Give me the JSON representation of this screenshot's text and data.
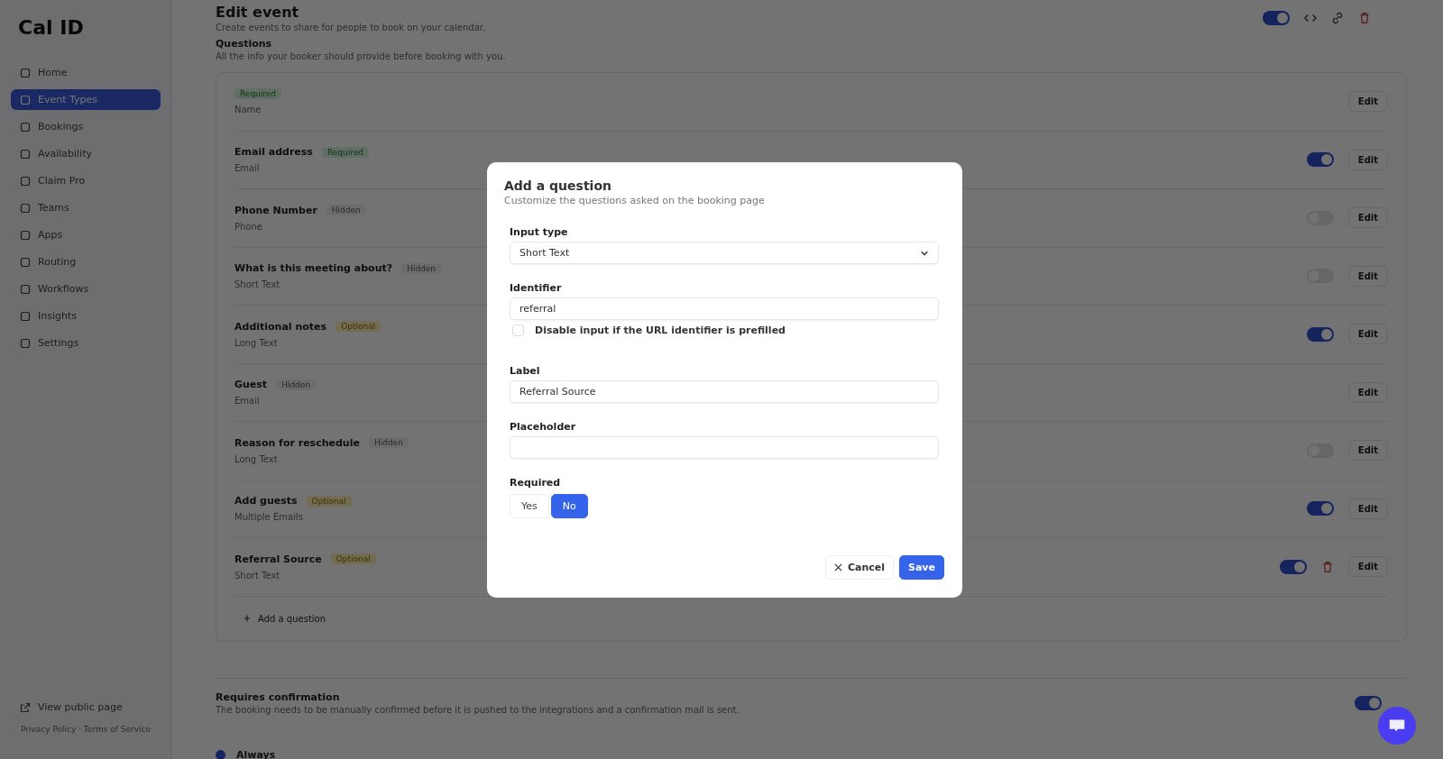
{
  "sidebar": {
    "logo": "Cal ID",
    "items": [
      {
        "label": "Home",
        "selected": false
      },
      {
        "label": "Event Types",
        "selected": true
      },
      {
        "label": "Bookings",
        "selected": false
      },
      {
        "label": "Availability",
        "selected": false
      },
      {
        "label": "Claim Pro",
        "selected": false
      },
      {
        "label": "Teams",
        "selected": false
      },
      {
        "label": "Apps",
        "selected": false
      },
      {
        "label": "Routing",
        "selected": false
      },
      {
        "label": "Workflows",
        "selected": false
      },
      {
        "label": "Insights",
        "selected": false
      },
      {
        "label": "Settings",
        "selected": false
      }
    ],
    "view_public_page": "View public page",
    "footer": "Privacy Policy · Terms of Service"
  },
  "header": {
    "title": "Edit event",
    "subtitle": "Create events to share for people to book on your calendar.",
    "switch_on": true
  },
  "questions": {
    "title": "Questions",
    "subtitle": "All the info your booker should provide before booking with you.",
    "rows": [
      {
        "badge": {
          "text": "Required",
          "kind": "required"
        },
        "type": "Name",
        "edit": "Edit"
      },
      {
        "label": "Email address",
        "badge": {
          "text": "Required",
          "kind": "required"
        },
        "type": "Email",
        "on": true,
        "edit": "Edit"
      },
      {
        "label": "Phone Number",
        "badge": {
          "text": "Hidden",
          "kind": "hidden"
        },
        "type": "Phone",
        "on": false,
        "edit": "Edit"
      },
      {
        "label": "What is this meeting about?",
        "badge": {
          "text": "Hidden",
          "kind": "hidden"
        },
        "type": "Short Text",
        "on": false,
        "edit": "Edit"
      },
      {
        "label": "Additional notes",
        "badge": {
          "text": "Optional",
          "kind": "optional"
        },
        "type": "Long Text",
        "on": true,
        "edit": "Edit"
      },
      {
        "label": "Guest",
        "badge": {
          "text": "Hidden",
          "kind": "hidden"
        },
        "type": "Email",
        "edit": "Edit"
      },
      {
        "label": "Reason for reschedule",
        "badge": {
          "text": "Hidden",
          "kind": "hidden"
        },
        "type": "Long Text",
        "on": false,
        "edit": "Edit"
      },
      {
        "label": "Add guests",
        "badge": {
          "text": "Optional",
          "kind": "optional"
        },
        "type": "Multiple Emails",
        "on": true,
        "edit": "Edit"
      },
      {
        "label": "Referral Source",
        "badge": {
          "text": "Optional",
          "kind": "optional"
        },
        "type": "Short Text",
        "on": true,
        "deletable": true,
        "edit": "Edit"
      }
    ],
    "add_label": "Add a question"
  },
  "confirmation": {
    "title": "Requires confirmation",
    "subtitle": "The booking needs to be manually confirmed before it is pushed to the integrations and a confirmation mail is sent.",
    "on": true,
    "option": "Always",
    "option_selected": true
  },
  "dialog": {
    "title": "Add a question",
    "subtitle": "Customize the questions asked on the booking page",
    "input_type": {
      "label": "Input type",
      "value": "Short Text"
    },
    "identifier": {
      "label": "Identifier",
      "value": "referral"
    },
    "disable_prefilled": {
      "label": "Disable input if the URL identifier is prefilled",
      "checked": false
    },
    "field_label": {
      "label": "Label",
      "value": "Referral Source"
    },
    "placeholder": {
      "label": "Placeholder"
    },
    "required": {
      "label": "Required",
      "options": [
        {
          "label": "Yes",
          "selected": false
        },
        {
          "label": "No",
          "selected": true
        }
      ]
    },
    "cancel": "Cancel",
    "save": "Save"
  }
}
